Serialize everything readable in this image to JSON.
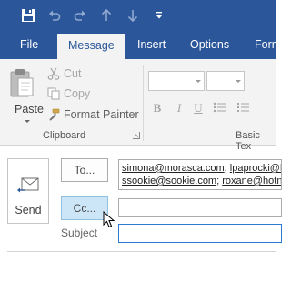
{
  "quick_access": {
    "icons": [
      "save-icon",
      "undo-icon",
      "redo-icon",
      "up-arrow-icon",
      "down-arrow-icon",
      "customize-icon"
    ]
  },
  "tabs": [
    {
      "label": "File",
      "active": false
    },
    {
      "label": "Message",
      "active": true
    },
    {
      "label": "Insert",
      "active": false
    },
    {
      "label": "Options",
      "active": false
    },
    {
      "label": "Form",
      "active": false
    }
  ],
  "clipboard": {
    "paste_label": "Paste",
    "cut_label": "Cut",
    "copy_label": "Copy",
    "format_painter_label": "Format Painter",
    "group_label": "Clipboard"
  },
  "basic_text": {
    "group_label": "Basic Tex",
    "format_buttons": [
      "B",
      "I",
      "U"
    ]
  },
  "compose": {
    "send_label": "Send",
    "to_label": "To...",
    "cc_label": "Cc...",
    "subject_label": "Subject",
    "to_line1": [
      {
        "text": "simona@morasca.com",
        "link": true
      },
      {
        "text": "; ",
        "link": false
      },
      {
        "text": "lpaprocki@h",
        "link": true
      }
    ],
    "to_line2": [
      {
        "text": "ssookie@sookie.com",
        "link": true
      },
      {
        "text": "; ",
        "link": false
      },
      {
        "text": "roxane@hotn",
        "link": true
      }
    ],
    "cc_value": "",
    "subject_value": ""
  },
  "colors": {
    "title_bar": "#2b579a",
    "ribbon": "#f3f3f3",
    "hover_button": "#cde6f7",
    "focus_border": "#2b7bd3"
  }
}
